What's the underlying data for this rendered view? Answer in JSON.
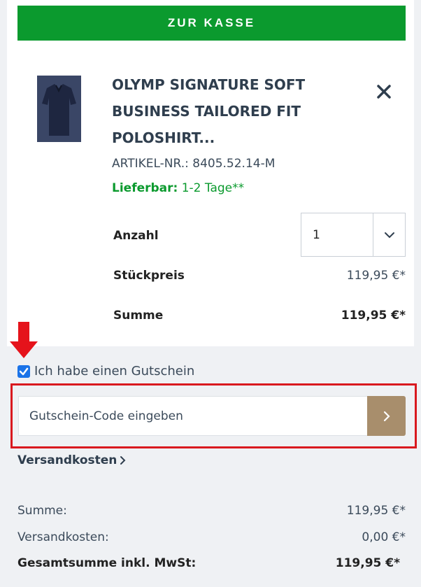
{
  "checkout": {
    "label": "ZUR KASSE"
  },
  "product": {
    "title": "OLYMP SIGNATURE SOFT BUSINESS TAILORED FIT POLOSHIRT...",
    "sku": "ARTIKEL-NR.: 8405.52.14-M",
    "availability_label": "Lieferbar:",
    "availability_value": "1-2 Tage**",
    "quantity_label": "Anzahl",
    "quantity_value": "1",
    "unit_price_label": "Stückpreis",
    "unit_price": "119,95 €*",
    "sum_label": "Summe",
    "sum": "119,95 €*"
  },
  "voucher": {
    "checkbox_label": "Ich habe einen Gutschein",
    "checked": true,
    "placeholder": "Gutschein-Code eingeben"
  },
  "shipping_link": {
    "label": "Versandkosten"
  },
  "summary": {
    "subtotal_label": "Summe:",
    "subtotal": "119,95 €*",
    "shipping_label": "Versandkosten:",
    "shipping": "0,00 €*",
    "total_label": "Gesamtsumme inkl. MwSt:",
    "total": "119,95 €*"
  },
  "colors": {
    "checkout_green": "#0b9a2e",
    "highlight_red": "#d9191f",
    "submit_brown": "#a88e6c"
  },
  "icons": {
    "remove": "close-icon",
    "qty_dropdown": "chevron-down-icon",
    "submit_code": "chevron-right-icon",
    "annotation": "red-arrow-down-icon"
  }
}
